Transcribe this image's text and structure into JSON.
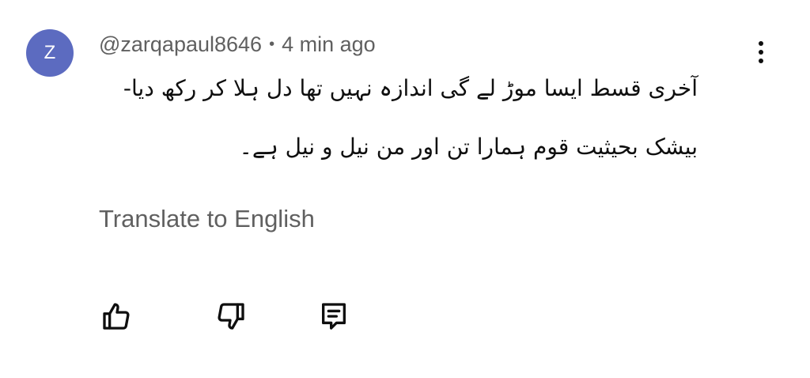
{
  "comment": {
    "avatar_letter": "Z",
    "avatar_color": "#5c6bc0",
    "username": "@zarqapaul8646",
    "separator": "•",
    "time": "4 min ago",
    "lines": [
      "آخری قسط ایسا موڑ لے گی اندازہ نہیں تھا دل ہلا کر رکھ دیا-",
      "بیشک بحیثیت قوم ہمارا تن اور من نیل و نیل ہے۔"
    ],
    "translate_label": "Translate to English"
  },
  "actions": {
    "like_icon": "thumbs-up-icon",
    "dislike_icon": "thumbs-down-icon",
    "reply_icon": "comment-icon",
    "more_icon": "more-vertical-icon"
  }
}
